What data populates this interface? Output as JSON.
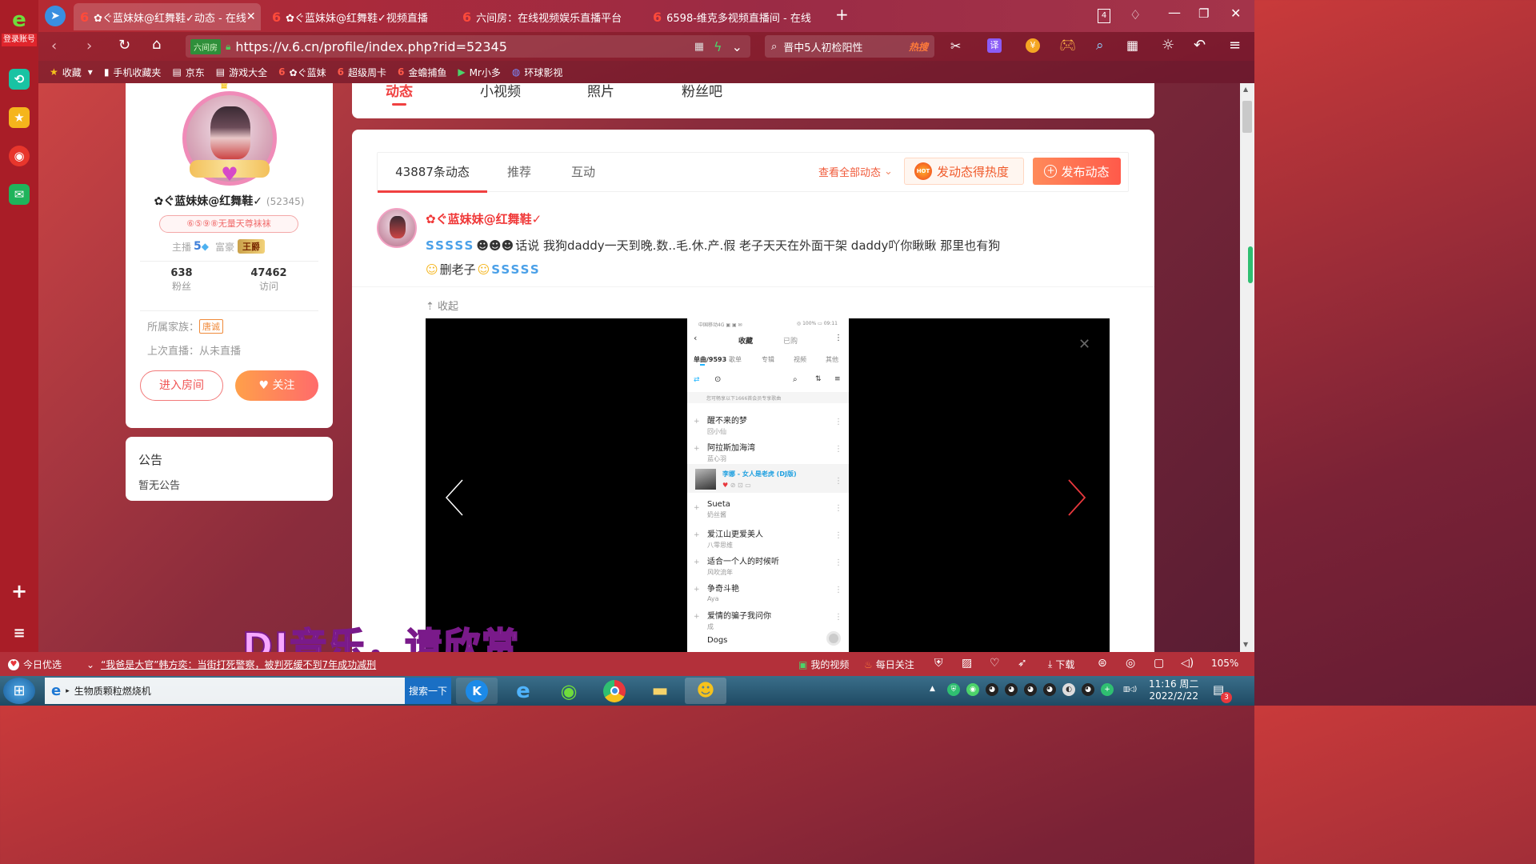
{
  "rail": {
    "login_label": "登录账号"
  },
  "tabs": [
    {
      "label": "✿ぐ蓝妹妹@红舞鞋✓动态 - 在线",
      "close": "✕"
    },
    {
      "label": "✿ぐ蓝妹妹@红舞鞋✓视频直播",
      "close": ""
    },
    {
      "label": "六间房：在线视频娱乐直播平台",
      "close": ""
    },
    {
      "label": "6598-维克多视频直播间 - 在线",
      "close": ""
    }
  ],
  "window": {
    "tab_count": "4",
    "new_tab": "+"
  },
  "nav": {
    "site_badge": "六间房",
    "url": "https://v.6.cn/profile/index.php?rid=52345",
    "search_text": "晋中5人初检阳性",
    "hot_label": "热搜"
  },
  "bookmarks": [
    {
      "label": "收藏",
      "icon": "star-icon"
    },
    {
      "label": "手机收藏夹",
      "icon": "phone-icon"
    },
    {
      "label": "京东",
      "icon": "doc-icon"
    },
    {
      "label": "游戏大全",
      "icon": "doc-icon"
    },
    {
      "label": "✿ぐ蓝妹",
      "icon": "six-icon"
    },
    {
      "label": "超级周卡",
      "icon": "six-icon"
    },
    {
      "label": "金蟾捕鱼",
      "icon": "six-icon"
    },
    {
      "label": "Mr小多",
      "icon": "six-icon"
    },
    {
      "label": "环球影视",
      "icon": "globe-icon"
    }
  ],
  "profile": {
    "name": "✿ぐ蓝妹妹@红舞鞋✓",
    "rid": "(52345)",
    "fan_club": "⑥⑤⑨⑧无量天尊袜袜",
    "anchor_label": "主播",
    "anchor_level": "5",
    "rich_label": "富豪",
    "rich_badge": "王爵",
    "fans_count": "638",
    "fans_label": "粉丝",
    "visits_count": "47462",
    "visits_label": "访问",
    "family_label": "所属家族：",
    "family_badge": "唐诚",
    "last_live": "上次直播：从未直播",
    "enter_room": "进入房间",
    "follow": "关注"
  },
  "notice": {
    "title": "公告",
    "body": "暂无公告"
  },
  "profile_tabs": [
    "动态",
    "小视频",
    "照片",
    "粉丝吧"
  ],
  "feed": {
    "tabs": [
      "43887条动态",
      "推荐",
      "互动"
    ],
    "view_all": "查看全部动态",
    "hot_btn": "发动态得热度",
    "hot_tag": "HOT",
    "publish_btn": "发布动态",
    "post": {
      "author": "✿ぐ蓝妹妹@红舞鞋✓",
      "text_line1": "话说 我狗daddy一天到晚.数..毛.休.产.假 老子天天在外面干架 daddy吖你瞅瞅 那里也有狗",
      "text_line2": "删老子",
      "collapse": "收起"
    }
  },
  "phone": {
    "status_left": "中国移动4G ▣ ▣ ✉",
    "status_right": "◎ 100% ▭ 09:11",
    "header_title": "收藏",
    "header_tab2": "已购",
    "tabs": [
      "单曲/9593",
      "歌单",
      "专辑",
      "视频",
      "其他"
    ],
    "vip_notice": "您可畅享以下1666首会员专享歌曲",
    "songs": [
      {
        "title": "醒不来的梦",
        "artist": "回小仙"
      },
      {
        "title": "阿拉斯加海湾",
        "artist": "蓝心羽"
      },
      {
        "title": "李娜 - 女人是老虎 (DJ版)",
        "artist": ""
      },
      {
        "title": "Sueta",
        "artist": "奶丝酱"
      },
      {
        "title": "爱江山更爱美人",
        "artist": "八零思维"
      },
      {
        "title": "适合一个人的时候听",
        "artist": "风吹流年"
      },
      {
        "title": "争奇斗艳",
        "artist": "Aya"
      },
      {
        "title": "爱情的骗子我问你",
        "artist": "成"
      },
      {
        "title": "Dogs",
        "artist": ""
      }
    ]
  },
  "overlay_caption": "DJ音乐，请欣赏",
  "statusbar": {
    "today": "今日优选",
    "news": "“我爸是大官”韩方奕：当街打死警察，被判死缓不到7年成功减刑",
    "my_video": "我的视频",
    "daily": "每日关注",
    "download": "下载",
    "zoom": "105%"
  },
  "taskbar": {
    "ie_title": "生物质颗粒燃烧机",
    "search_btn": "搜索一下",
    "time": "11:16 周二",
    "date": "2022/2/22",
    "badge": "3"
  },
  "colors": {
    "brand_red": "#e8383d",
    "orange": "#ff6a3d",
    "tab_active": "#ff5050"
  }
}
